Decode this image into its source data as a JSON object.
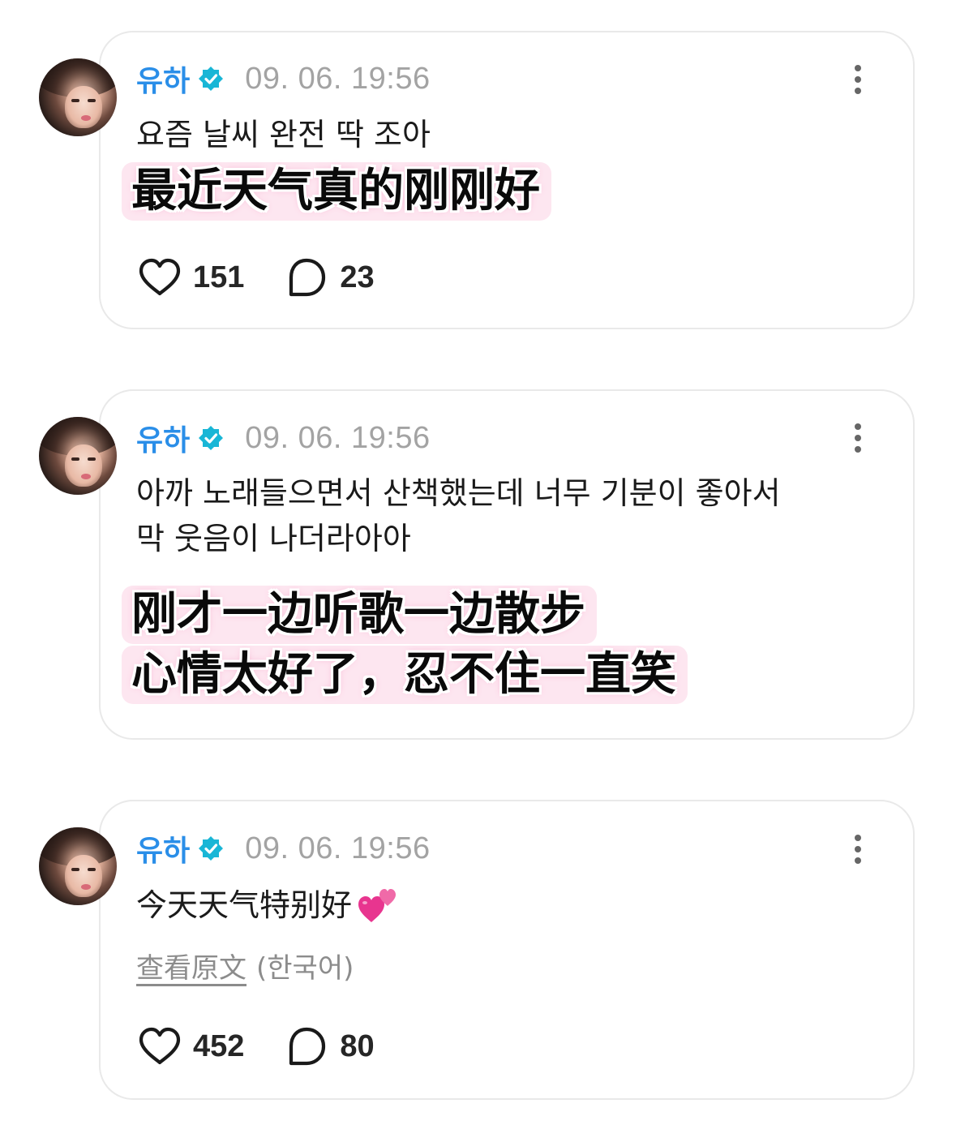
{
  "posts": [
    {
      "author": "유하",
      "timestamp": "09. 06. 19:56",
      "text_lines": [
        "요즘 날씨 완전 딱 조아"
      ],
      "caption_lines": [
        "最近天气真的刚刚好"
      ],
      "likes": "151",
      "comments": "23"
    },
    {
      "author": "유하",
      "timestamp": "09. 06. 19:56",
      "text_lines": [
        "아까 노래들으면서 산책했는데 너무 기분이 좋아서",
        "막 웃음이 나더라아아"
      ],
      "caption_lines": [
        "刚才一边听歌一边散步",
        "心情太好了，忍不住一直笑"
      ]
    },
    {
      "author": "유하",
      "timestamp": "09. 06. 19:56",
      "translated_text": "今天天气特别好",
      "emoji": "two-hearts",
      "see_original": "查看原文",
      "original_language": "(한국어)",
      "likes": "452",
      "comments": "80"
    }
  ],
  "colors": {
    "name": "#2a8ee8",
    "verified": "#19b6d6",
    "timestamp": "#a3a3a3",
    "caption_highlight": "#fde6f0",
    "card_border": "#e9e9e9"
  },
  "icons": [
    "verified-badge-icon",
    "more-vertical-icon",
    "heart-icon",
    "comment-bubble-icon",
    "two-hearts-emoji-icon"
  ]
}
